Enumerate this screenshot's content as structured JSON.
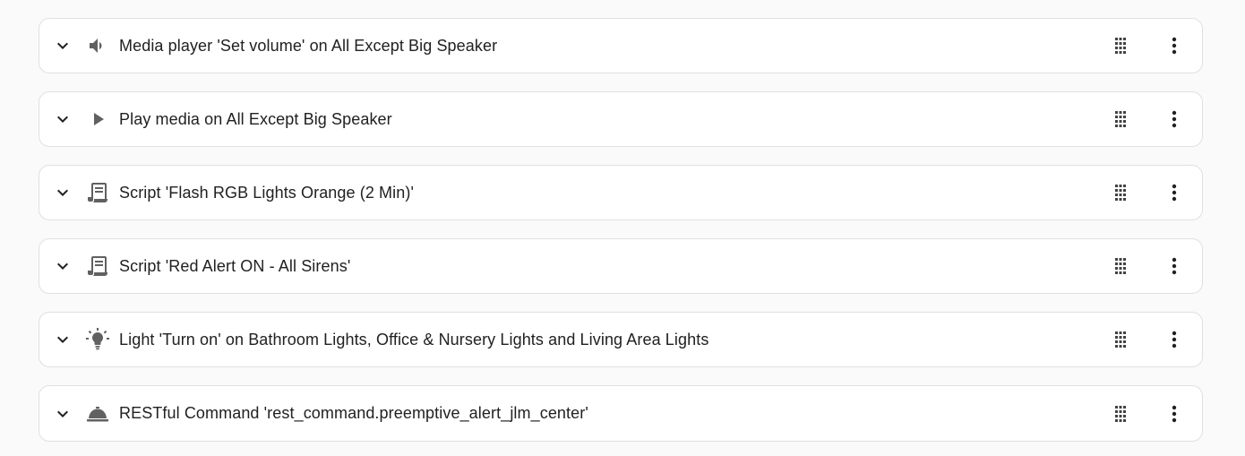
{
  "actions": [
    {
      "label": "Media player 'Set volume' on All Except Big Speaker",
      "icon": "volume-icon"
    },
    {
      "label": "Play media on All Except Big Speaker",
      "icon": "play-icon"
    },
    {
      "label": "Script 'Flash RGB Lights Orange (2 Min)'",
      "icon": "script-icon"
    },
    {
      "label": "Script 'Red Alert ON - All Sirens'",
      "icon": "script-icon"
    },
    {
      "label": "Light 'Turn on' on Bathroom Lights, Office & Nursery Lights and Living Area Lights",
      "icon": "lightbulb-icon"
    },
    {
      "label": "RESTful Command 'rest_command.preemptive_alert_jlm_center'",
      "icon": "service-bell-icon"
    }
  ],
  "colors": {
    "icon": "#616161",
    "icon_dark": "#424242",
    "text": "#212121",
    "border": "#e0e0e0",
    "background": "#fafafa",
    "card": "#ffffff"
  }
}
